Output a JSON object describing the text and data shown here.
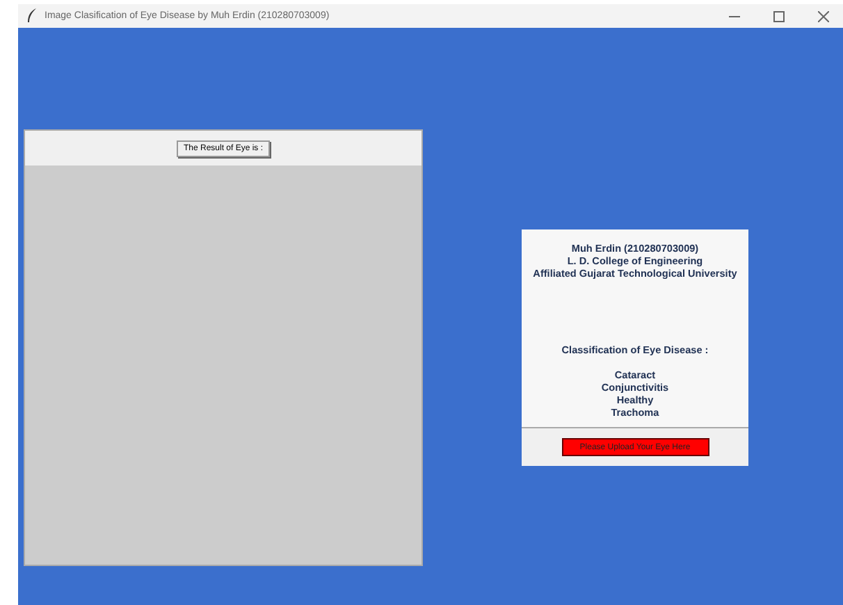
{
  "window": {
    "title": "Image Clasification of Eye Disease by Muh Erdin (210280703009)"
  },
  "result_panel": {
    "button": "The Result of Eye is :"
  },
  "info_card": {
    "author_lines": [
      "Muh Erdin (210280703009)",
      "L. D. College of Engineering",
      "Affiliated Gujarat Technological University"
    ],
    "classes_title": "Classification of Eye Disease :",
    "classes": [
      "Cataract",
      "Conjunctivitis",
      "Healthy",
      "Trachoma"
    ],
    "upload_button": "Please Upload Your Eye Here"
  }
}
